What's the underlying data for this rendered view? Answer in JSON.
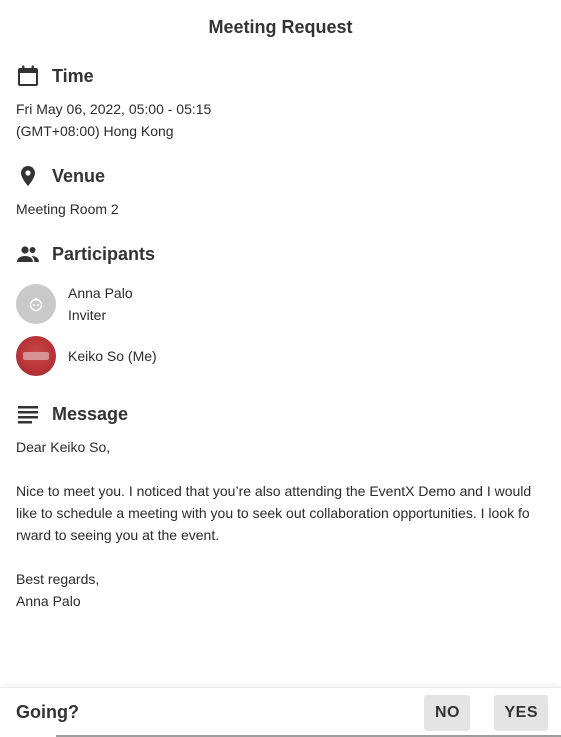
{
  "header": {
    "title": "Meeting Request"
  },
  "time": {
    "heading": "Time",
    "icon": "calendar-icon",
    "line1": "Fri May 06, 2022, 05:00 - 05:15",
    "line2": "(GMT+08:00) Hong Kong"
  },
  "venue": {
    "heading": "Venue",
    "icon": "map-pin-icon",
    "name": "Meeting Room 2"
  },
  "participants": {
    "heading": "Participants",
    "icon": "people-icon",
    "items": [
      {
        "name": "Anna Palo",
        "role": "Inviter",
        "avatar": "default-avatar"
      },
      {
        "name": "Keiko So (Me)",
        "role": "",
        "avatar": "photo-avatar"
      }
    ]
  },
  "message": {
    "heading": "Message",
    "icon": "text-lines-icon",
    "greeting": "Dear Keiko So,",
    "body": "Nice to meet you. I noticed that you’re also attending the EventX Demo and I would like to schedule a meeting with you to seek out collaboration opportunities. I look fo rward to seeing you at the event.",
    "signoff": "Best regards,",
    "signature": "Anna Palo"
  },
  "footer": {
    "question": "Going?",
    "no_label": "NO",
    "yes_label": "YES"
  },
  "colors": {
    "text": "#2b2b2b",
    "button_bg": "#e4e4e4",
    "default_avatar": "#c9c9c9",
    "photo_avatar": "#b93438"
  }
}
